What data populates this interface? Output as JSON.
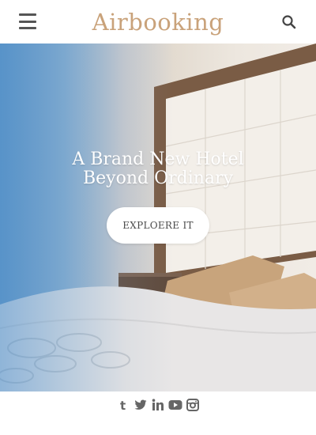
{
  "header": {
    "logo": "Airbooking",
    "menu_icon": "hamburger-menu-icon",
    "search_icon": "search-icon"
  },
  "hero": {
    "title": "A Brand New Hotel Beyond Ordinary",
    "cta_label": "EXPLOERE IT"
  },
  "footer": {
    "social": [
      "tumblr-icon",
      "twitter-icon",
      "linkedin-icon",
      "youtube-icon",
      "instagram-icon"
    ]
  },
  "colors": {
    "brand": "#c9a27a",
    "icons": "#666666"
  }
}
